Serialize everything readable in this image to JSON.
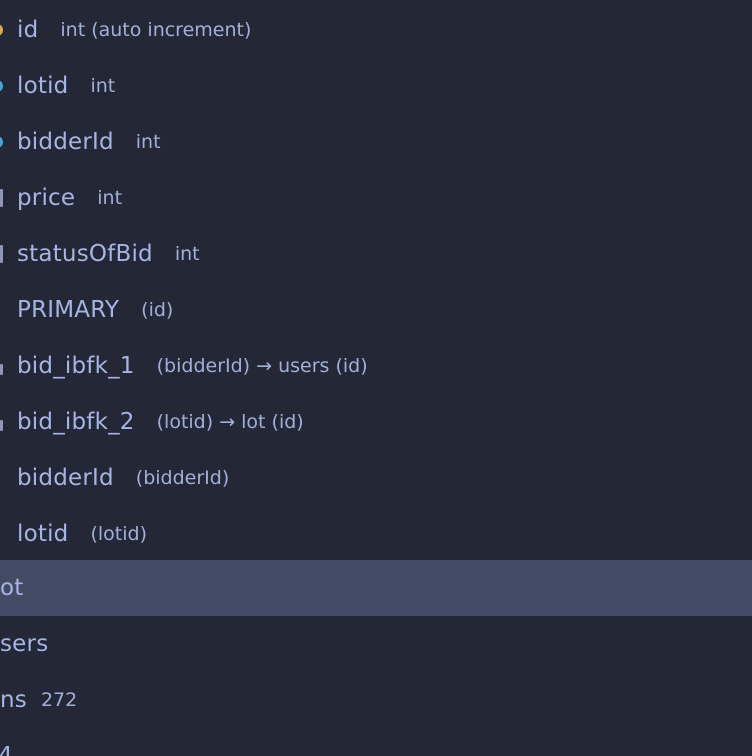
{
  "tree": {
    "columns": [
      {
        "name": "id",
        "type": "int (auto increment)",
        "icon": "primary-key-icon"
      },
      {
        "name": "lotid",
        "type": "int",
        "icon": "foreign-key-icon"
      },
      {
        "name": "bidderId",
        "type": "int",
        "icon": "foreign-key-icon"
      },
      {
        "name": "price",
        "type": "int",
        "icon": "column-icon"
      },
      {
        "name": "statusOfBid",
        "type": "int",
        "icon": "column-icon"
      }
    ],
    "keys": [
      {
        "name": "PRIMARY",
        "detail": "(id)"
      },
      {
        "name": "bid_ibfk_1",
        "detail": "(bidderId) → users (id)"
      },
      {
        "name": "bid_ibfk_2",
        "detail": "(lotid) → lot (id)"
      }
    ],
    "indexes": [
      {
        "name": "bidderId",
        "detail": "(bidderId)"
      },
      {
        "name": "lotid",
        "detail": "(lotid)"
      }
    ],
    "tables": [
      {
        "name": "ot"
      },
      {
        "name": "sers"
      },
      {
        "name": "ns",
        "count": "272"
      }
    ]
  },
  "colors": {
    "background": "#232736",
    "selected_row": "#434a63",
    "text": "#a7b4e6",
    "primary_key": "#e6a84a",
    "foreign_key": "#45a7de"
  }
}
